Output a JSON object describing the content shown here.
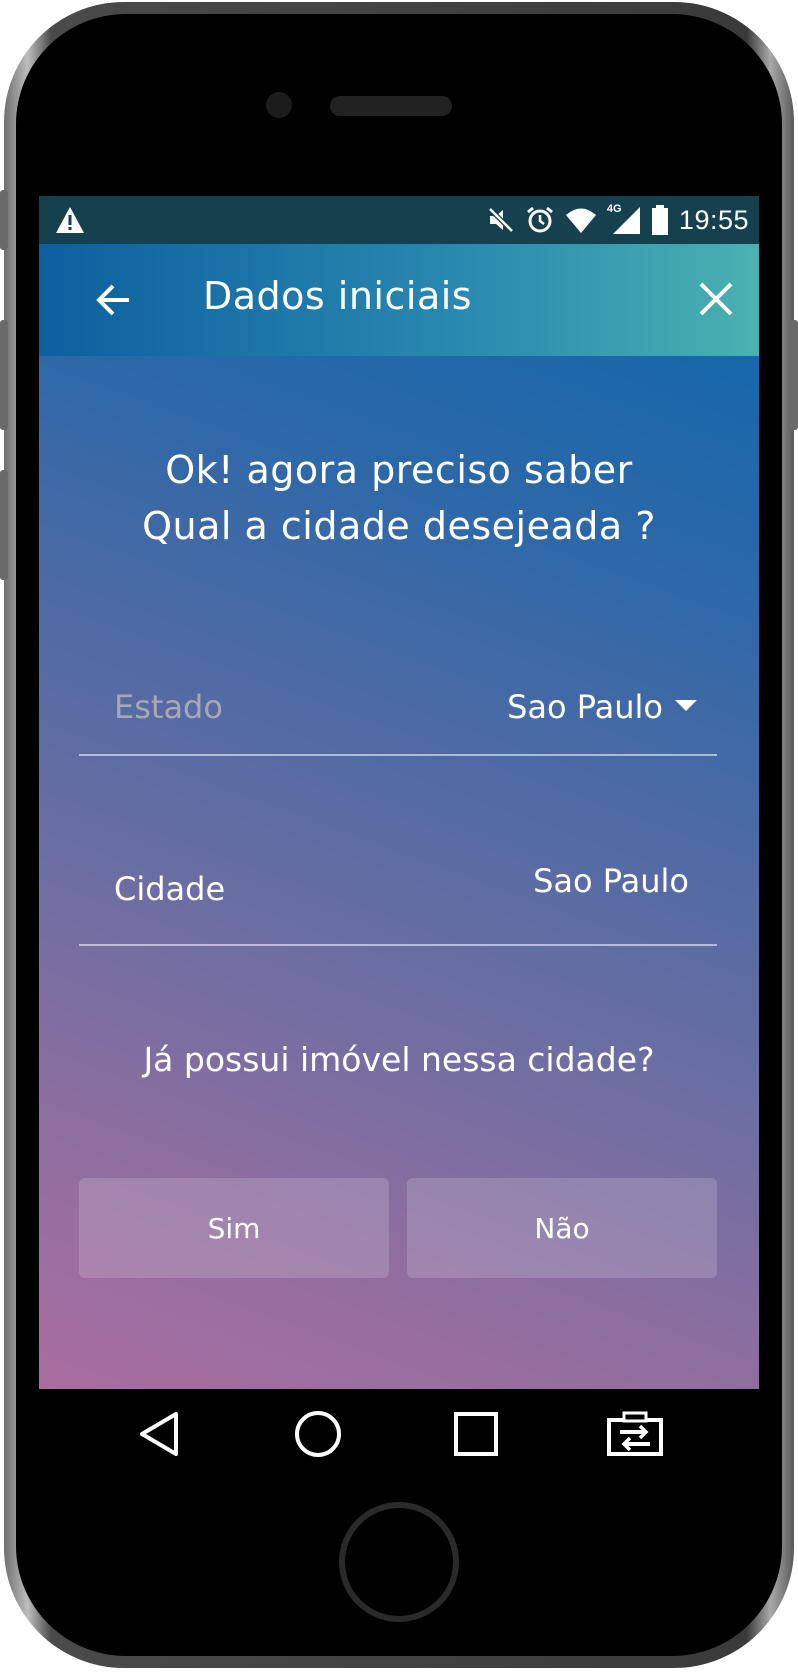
{
  "status_bar": {
    "time": "19:55",
    "network_label": "4G",
    "icons": [
      "warning-icon",
      "mute-icon",
      "alarm-icon",
      "wifi-icon",
      "signal-icon",
      "battery-icon"
    ]
  },
  "app_bar": {
    "title": "Dados iniciais",
    "back_icon": "arrow-left-icon",
    "close_icon": "close-icon"
  },
  "main": {
    "question_line1": "Ok! agora preciso saber",
    "question_line2": "Qual a cidade desejeada ?",
    "estado": {
      "label": "Estado",
      "value": "Sao Paulo"
    },
    "cidade": {
      "label": "Cidade",
      "value": "Sao Paulo"
    },
    "owns_question": "Já possui imóvel nessa cidade?",
    "choices": {
      "yes": "Sim",
      "no": "Não"
    }
  },
  "nav_bar": {
    "icons": [
      "back-triangle-icon",
      "home-circle-icon",
      "recents-square-icon",
      "screen-swap-icon"
    ]
  },
  "colors": {
    "status_bar": "#15404e",
    "app_bar_start": "#0d5f9f",
    "app_bar_end": "#4bb1b0",
    "gradient_top": "#1667ab",
    "gradient_bottom": "#a96d9f"
  }
}
